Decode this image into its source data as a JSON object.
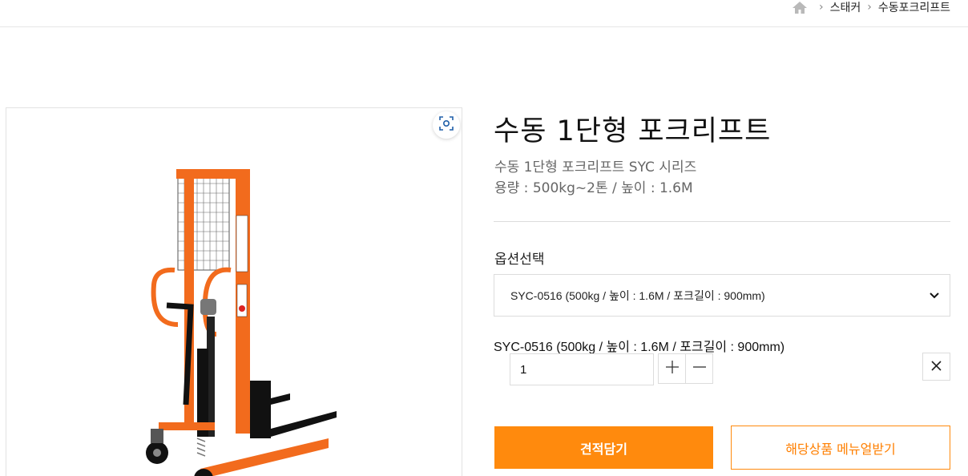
{
  "breadcrumb": {
    "home_icon": "home-icon",
    "items": [
      "스태커",
      "수동포크리프트"
    ]
  },
  "product": {
    "title": "수동 1단형 포크리프트",
    "subtitle_line1": "수동 1단형 포크리프트 SYC 시리즈",
    "subtitle_line2": "용량 : 500kg~2톤 / 높이 : 1.6M"
  },
  "options": {
    "label": "옵션선택",
    "selected_value": "SYC-0516 (500kg / 높이 : 1.6M / 포크길이 : 900mm)"
  },
  "selected_item": {
    "name": "SYC-0516 (500kg / 높이 : 1.6M / 포크길이 : 900mm)",
    "quantity": "1"
  },
  "buttons": {
    "quote_label": "견적담기",
    "manual_label": "해당상품 메뉴얼받기"
  },
  "colors": {
    "accent": "#ff8a0d",
    "product_orange": "#f26b1d"
  }
}
